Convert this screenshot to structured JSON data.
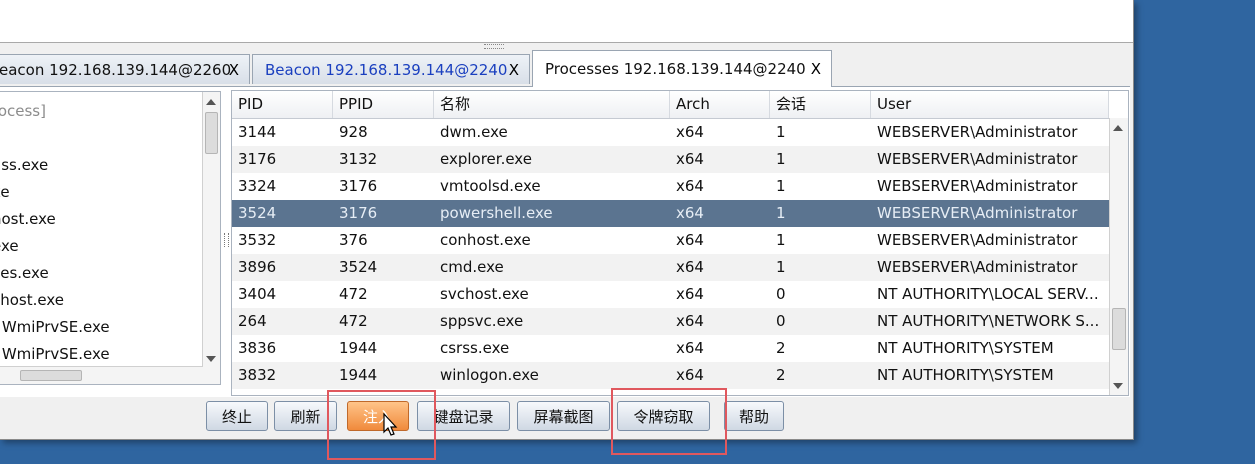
{
  "tabs": [
    {
      "title": "eacon 192.168.139.144@2260",
      "close": "X",
      "style": "normal"
    },
    {
      "title": "Beacon 192.168.139.144@2240",
      "close": "X",
      "style": "blue"
    },
    {
      "title": "Processes 192.168.139.144@2240",
      "close": "X",
      "style": "active"
    }
  ],
  "tree": {
    "items": [
      "rocess]",
      "",
      "ass.exe",
      "xe",
      "nost.exe",
      "exe",
      "ces.exe",
      "chost.exe",
      ": WmiPrvSE.exe",
      ": WmiPrvSE.exe"
    ]
  },
  "process_table": {
    "columns": [
      "PID",
      "PPID",
      "名称",
      "Arch",
      "会话",
      "User"
    ],
    "rows": [
      [
        "3144",
        "928",
        "dwm.exe",
        "x64",
        "1",
        "WEBSERVER\\Administrator"
      ],
      [
        "3176",
        "3132",
        "explorer.exe",
        "x64",
        "1",
        "WEBSERVER\\Administrator"
      ],
      [
        "3324",
        "3176",
        "vmtoolsd.exe",
        "x64",
        "1",
        "WEBSERVER\\Administrator"
      ],
      [
        "3524",
        "3176",
        "powershell.exe",
        "x64",
        "1",
        "WEBSERVER\\Administrator"
      ],
      [
        "3532",
        "376",
        "conhost.exe",
        "x64",
        "1",
        "WEBSERVER\\Administrator"
      ],
      [
        "3896",
        "3524",
        "cmd.exe",
        "x64",
        "1",
        "WEBSERVER\\Administrator"
      ],
      [
        "3404",
        "472",
        "svchost.exe",
        "x64",
        "0",
        "NT AUTHORITY\\LOCAL SERV..."
      ],
      [
        "264",
        "472",
        "sppsvc.exe",
        "x64",
        "0",
        "NT AUTHORITY\\NETWORK S..."
      ],
      [
        "3836",
        "1944",
        "csrss.exe",
        "x64",
        "2",
        "NT AUTHORITY\\SYSTEM"
      ],
      [
        "3832",
        "1944",
        "winlogon.exe",
        "x64",
        "2",
        "NT AUTHORITY\\SYSTEM"
      ]
    ],
    "selected_row_index": 3
  },
  "buttons": {
    "kill": "终止",
    "refresh": "刷新",
    "inject": "注入",
    "keylog": "键盘记录",
    "screenshot": "屏幕截图",
    "steal_token": "令牌窃取",
    "help": "帮助"
  },
  "colors": {
    "selected_row": "#5b7490",
    "highlight_box": "#e0585e",
    "inject_button": "#f08a3c",
    "blue_tab_text": "#1a3fbf"
  }
}
